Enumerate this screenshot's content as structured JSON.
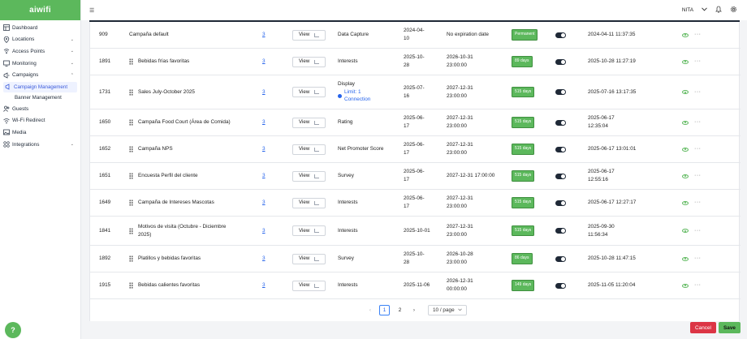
{
  "brand": {
    "logo_text": "aiwifi",
    "color": "#5cb85c"
  },
  "topbar": {
    "menu_icon": "hamburger-icon",
    "user": "NITA"
  },
  "sidebar": {
    "items": [
      {
        "label": "Dashboard",
        "icon": "dashboard-icon",
        "chevron": ""
      },
      {
        "label": "Locations",
        "icon": "location-pin-icon",
        "chevron": "⌄"
      },
      {
        "label": "Access Points",
        "icon": "access-point-icon",
        "chevron": "⌄"
      },
      {
        "label": "Monitoring",
        "icon": "monitoring-icon",
        "chevron": "⌄"
      },
      {
        "label": "Campaigns",
        "icon": "campaigns-icon",
        "chevron": "⌃"
      }
    ],
    "campaign_subitems": [
      {
        "label": "Campaign Management",
        "icon": "campaign-management-icon"
      },
      {
        "label": "Banner Management"
      }
    ],
    "items_after": [
      {
        "label": "Guests",
        "icon": "guests-icon",
        "chevron": ""
      },
      {
        "label": "Wi-Fi Redirect",
        "icon": "wifi-icon",
        "chevron": ""
      },
      {
        "label": "Media",
        "icon": "media-icon",
        "chevron": ""
      },
      {
        "label": "Integrations",
        "icon": "integrations-icon",
        "chevron": "⌄"
      }
    ]
  },
  "table": {
    "view_label": "View",
    "rows": [
      {
        "id": "909",
        "name": "Campaña default",
        "count": "3",
        "type": "Data Capture",
        "start": "2024-04-\n10",
        "end": "No expiration date",
        "badge": "Permanent",
        "created": "2024-04-11 11:37:35"
      },
      {
        "id": "1891",
        "name": "Bebidas frías favoritas",
        "count": "3",
        "type": "Interests",
        "start": "2025-10-\n28",
        "end": "2026-10-31\n23:00:00",
        "badge": "89 days",
        "created": "2025-10-28 11:27:19"
      },
      {
        "id": "1731",
        "name": "Sales July-October 2025",
        "count": "3",
        "type": "Display",
        "limit": "Limit: 1\nConnection",
        "start": "2025-07-\n16",
        "end": "2027-12-31\n23:00:00",
        "badge": "515 days",
        "created": "2025-07-16 13:17:35"
      },
      {
        "id": "1650",
        "name": "Campaña Food Court (Área de Comida)",
        "count": "3",
        "type": "Rating",
        "start": "2025-06-\n17",
        "end": "2027-12-31\n23:00:00",
        "badge": "515 days",
        "created": "2025-06-17\n12:35:04"
      },
      {
        "id": "1652",
        "name": "Campaña NPS",
        "count": "3",
        "type": "Net Promoter Score",
        "start": "2025-06-\n17",
        "end": "2027-12-31\n23:00:00",
        "badge": "515 days",
        "created": "2025-06-17 13:01:01"
      },
      {
        "id": "1651",
        "name": "Encuesta Perfil del cliente",
        "count": "3",
        "type": "Survey",
        "start": "2025-06-\n17",
        "end": "2027-12-31 17:00:00",
        "badge": "515 days",
        "created": "2025-06-17\n12:55:16"
      },
      {
        "id": "1649",
        "name": "Campaña de Intereses Mascotas",
        "count": "3",
        "type": "Interests",
        "start": "2025-06-\n17",
        "end": "2027-12-31\n23:00:00",
        "badge": "515 days",
        "created": "2025-06-17 12:27:17"
      },
      {
        "id": "1841",
        "name": "Motivos de visita (Octubre - Diciembre\n2025)",
        "count": "3",
        "type": "Interests",
        "start": "2025-10-01",
        "end": "2027-12-31\n23:00:00",
        "badge": "515 days",
        "created": "2025-09-30\n11:56:34"
      },
      {
        "id": "1892",
        "name": "Platillos y bebidas favoritas",
        "count": "3",
        "type": "Survey",
        "start": "2025-10-\n28",
        "end": "2026-10-28\n23:00:00",
        "badge": "86 days",
        "created": "2025-10-28 11:47:15"
      },
      {
        "id": "1915",
        "name": "Bebidas calientes favoritas",
        "count": "3",
        "type": "Interests",
        "start": "2025-11-06",
        "end": "2026-12-31\n00:00:00",
        "badge": "149 days",
        "created": "2025-11-05 11:20:04"
      }
    ]
  },
  "pagination": {
    "prev": "‹",
    "pages": [
      "1",
      "2"
    ],
    "current": "1",
    "next": "›",
    "page_size": "10 / page"
  },
  "footer": {
    "cancel": "Cancel",
    "save": "Save",
    "help": "?"
  }
}
